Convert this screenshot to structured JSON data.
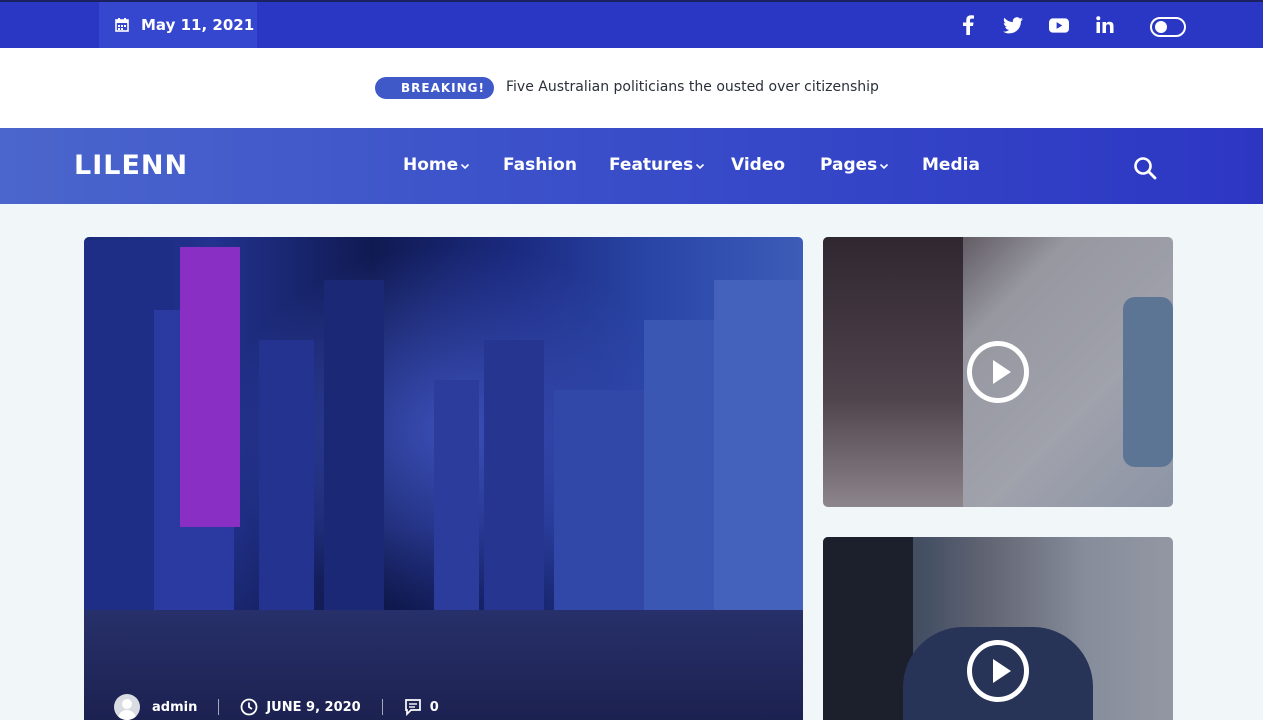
{
  "topbar": {
    "date": "May 11, 2021",
    "icons": [
      "calendar-icon",
      "facebook-icon",
      "twitter-icon",
      "youtube-icon",
      "linkedin-icon"
    ],
    "dark_mode_toggle": "off"
  },
  "breaking": {
    "label": "BREAKING!",
    "headline": "Five Australian politicians the ousted over citizenship"
  },
  "nav": {
    "logo": "LILENN",
    "items": [
      {
        "label": "Home",
        "dropdown": true
      },
      {
        "label": "Fashion",
        "dropdown": false
      },
      {
        "label": "Features",
        "dropdown": true
      },
      {
        "label": "Video",
        "dropdown": false
      },
      {
        "label": "Pages",
        "dropdown": true
      },
      {
        "label": "Media",
        "dropdown": false
      }
    ],
    "search_icon": "search-icon"
  },
  "hero": {
    "author": "admin",
    "date": "JUNE 9, 2020",
    "comments": "0"
  },
  "colors": {
    "topbar": "#2937c4",
    "date_box": "#3647cf",
    "nav_start": "#4b66cc",
    "nav_end": "#2c36c3",
    "breaking_badge": "#4059c8",
    "page_bg": "#f1f6f9"
  }
}
